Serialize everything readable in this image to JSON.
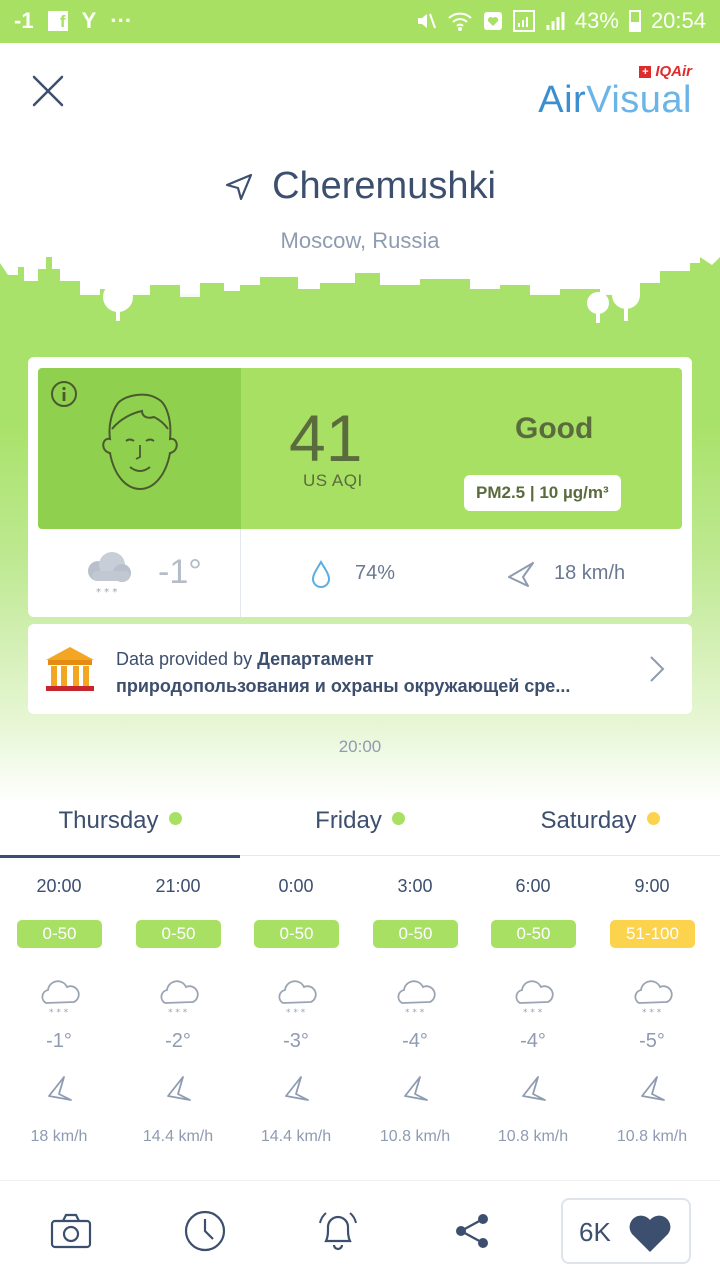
{
  "status_bar": {
    "left_text": "-1",
    "fb": "f",
    "y_glyph": "Y",
    "dots": "···",
    "battery": "43%",
    "time": "20:54"
  },
  "brand": {
    "iq": "IQAir",
    "air_a": "Air",
    "air_b": "Visual"
  },
  "location": {
    "city": "Cheremushki",
    "country": "Moscow, Russia"
  },
  "aqi": {
    "value": "41",
    "unit": "US AQI",
    "level": "Good",
    "pollutant": "PM2.5 | 10 µg/m³"
  },
  "weather": {
    "temp": "-1°",
    "humidity": "74%",
    "wind": "18 km/h"
  },
  "provider": {
    "prefix": "Data provided by ",
    "name_line1": "Департамент",
    "name_line2": "природопользования и охраны окружающей сре..."
  },
  "updated": "20:00",
  "tabs": [
    {
      "label": "Thursday",
      "dot_color": "#a8e063"
    },
    {
      "label": "Friday",
      "dot_color": "#a8e063"
    },
    {
      "label": "Saturday",
      "dot_color": "#fcd34d"
    }
  ],
  "forecast": [
    {
      "time": "20:00",
      "aqi": "0-50",
      "color": "#a8e063",
      "temp": "-1°",
      "wind": "18 km/h"
    },
    {
      "time": "21:00",
      "aqi": "0-50",
      "color": "#a8e063",
      "temp": "-2°",
      "wind": "14.4 km/h"
    },
    {
      "time": "0:00",
      "aqi": "0-50",
      "color": "#a8e063",
      "temp": "-3°",
      "wind": "14.4 km/h"
    },
    {
      "time": "3:00",
      "aqi": "0-50",
      "color": "#a8e063",
      "temp": "-4°",
      "wind": "10.8 km/h"
    },
    {
      "time": "6:00",
      "aqi": "0-50",
      "color": "#a8e063",
      "temp": "-4°",
      "wind": "10.8 km/h"
    },
    {
      "time": "9:00",
      "aqi": "51-100",
      "color": "#fcd34d",
      "temp": "-5°",
      "wind": "10.8 km/h"
    }
  ],
  "favorites": {
    "count": "6K"
  },
  "colors": {
    "good": "#a8e063",
    "good_dark": "#8fd14f",
    "moderate": "#fcd34d",
    "text_dark": "#3d4f6e"
  }
}
